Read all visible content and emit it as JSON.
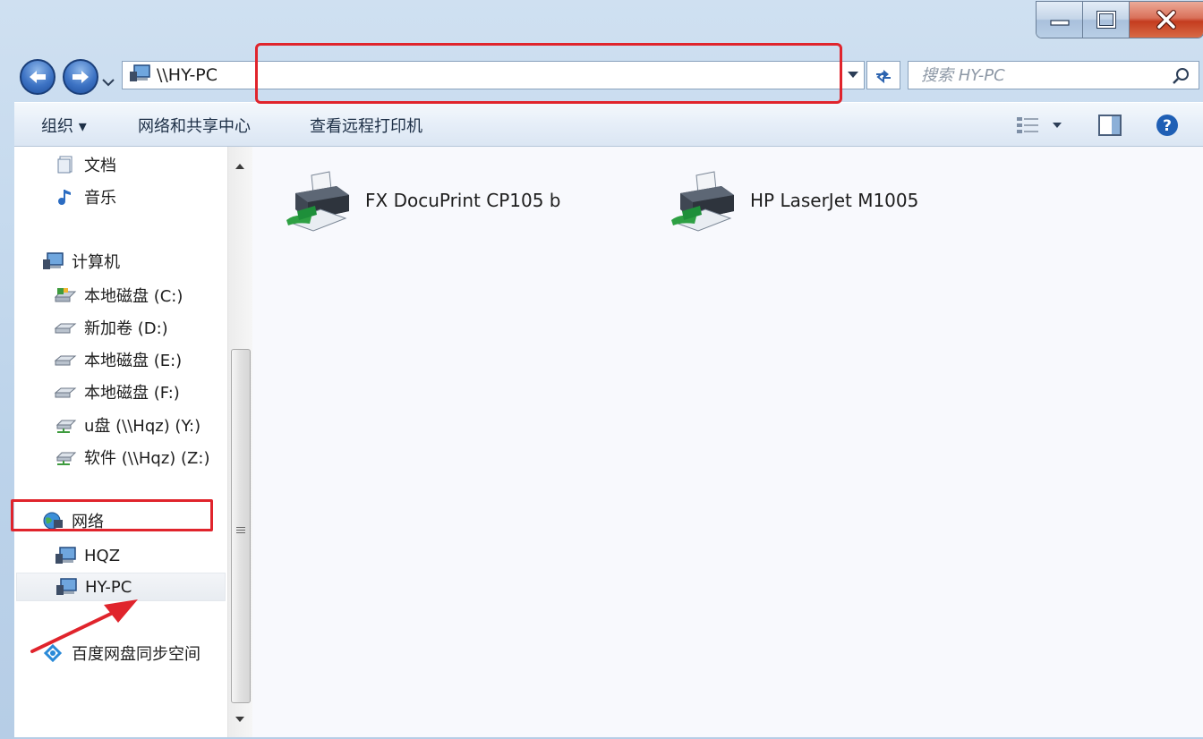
{
  "window": {
    "buttons": [
      "minimize",
      "maximize",
      "close"
    ]
  },
  "address_bar": {
    "path": "\\\\HY-PC"
  },
  "search": {
    "placeholder": "搜索 HY-PC"
  },
  "toolbar": {
    "organize_label": "组织 ▾",
    "network_center_label": "网络和共享中心",
    "view_printers_label": "查看远程打印机"
  },
  "nav_pane": {
    "documents": "文档",
    "music": "音乐",
    "computer": "计算机",
    "drive_c": "本地磁盘 (C:)",
    "drive_d": "新加卷 (D:)",
    "drive_e": "本地磁盘 (E:)",
    "drive_f": "本地磁盘 (F:)",
    "drive_y": "u盘 (\\\\Hqz) (Y:)",
    "drive_z": "软件 (\\\\Hqz) (Z:)",
    "network": "网络",
    "hqz": "HQZ",
    "hypc": "HY-PC",
    "baidu": "百度网盘同步空间"
  },
  "printers": [
    {
      "name": "FX DocuPrint CP105 b"
    },
    {
      "name": "HP LaserJet M1005"
    }
  ],
  "colors": {
    "highlight_annotation": "#e0242c",
    "chrome_blue": "#bcd3ea"
  }
}
